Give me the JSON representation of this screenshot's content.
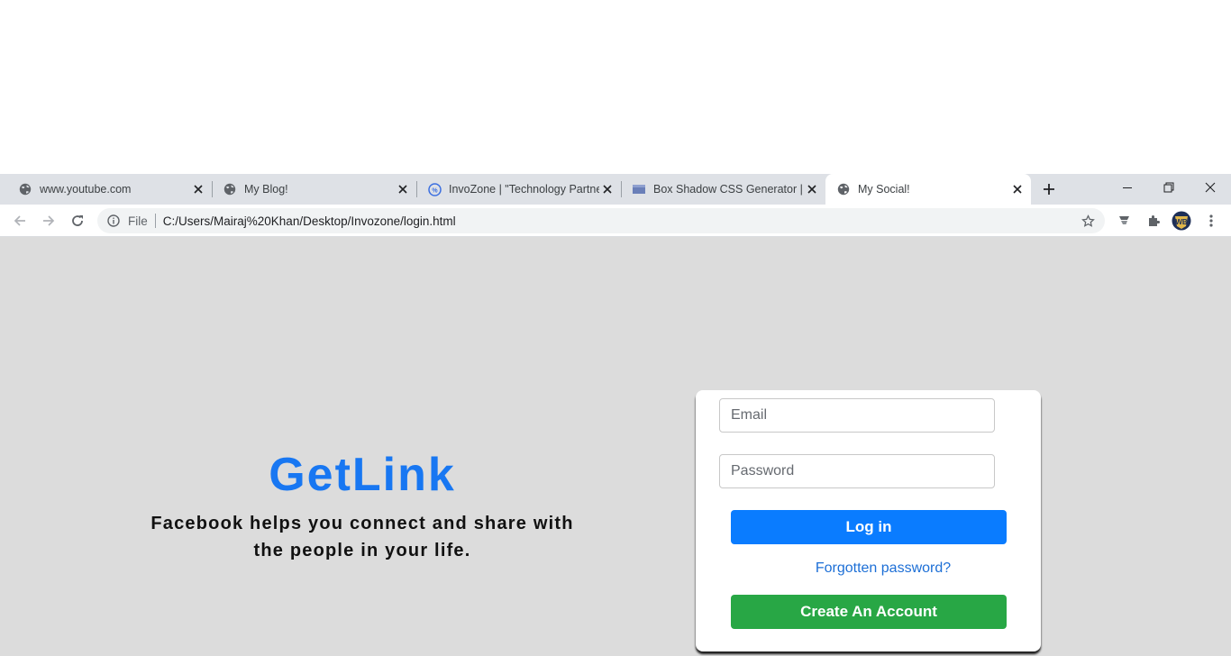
{
  "browser": {
    "tabs": [
      {
        "title": "www.youtube.com",
        "favicon": "globe-icon"
      },
      {
        "title": "My Blog!",
        "favicon": "globe-icon"
      },
      {
        "title": "InvoZone | \"Technology Partner",
        "favicon": "invozone-logo-icon"
      },
      {
        "title": "Box Shadow CSS Generator | C",
        "favicon": "box-shadow-favicon-icon"
      },
      {
        "title": "My Social!",
        "favicon": "globe-icon",
        "active": true
      }
    ],
    "address": {
      "scheme_label": "File",
      "url": "C:/Users/Mairaj%20Khan/Desktop/Invozone/login.html"
    }
  },
  "page": {
    "background": "#dcdcdc",
    "brand": {
      "text": "GetLink",
      "color": "#1877f2"
    },
    "tagline": "Facebook helps you connect and share with the people in your life.",
    "form": {
      "email_placeholder": "Email",
      "password_placeholder": "Password",
      "login_label": "Log in",
      "forgot_label": "Forgotten password?",
      "create_label": "Create An Account",
      "login_color": "#0a7cff",
      "create_color": "#28a745"
    }
  }
}
